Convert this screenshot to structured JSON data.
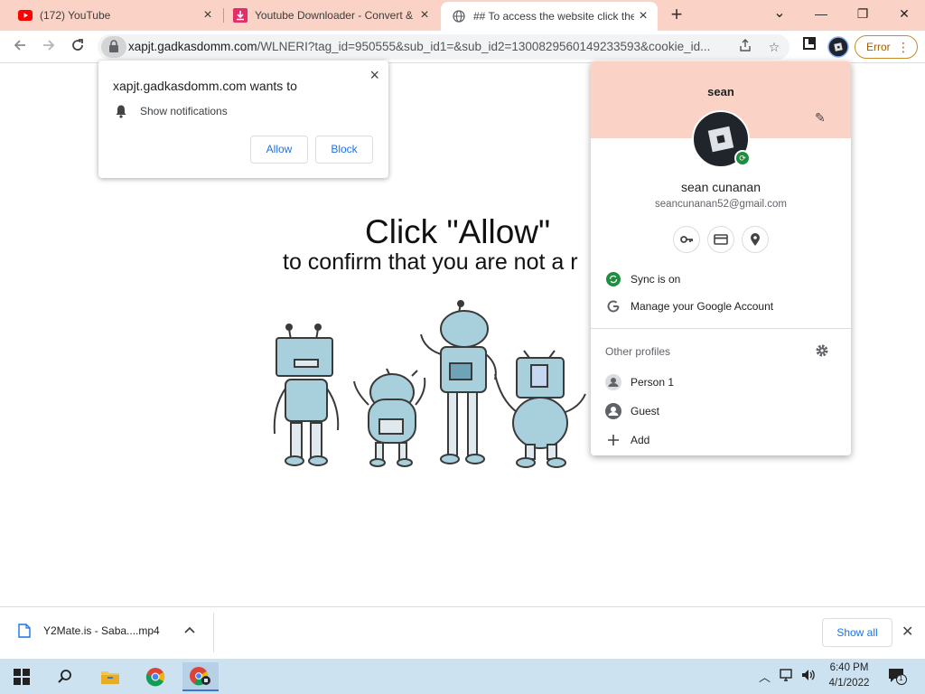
{
  "tabs": [
    {
      "title": "(172) YouTube",
      "icon": "youtube-icon"
    },
    {
      "title": "Youtube Downloader - Convert & ",
      "icon": "download-icon"
    },
    {
      "title": "## To access the website click the",
      "icon": "globe-icon",
      "active": true
    }
  ],
  "window": {
    "minimize": "—",
    "restore": "❐",
    "close": "✕",
    "tab_list": "⌄",
    "new_tab": "+"
  },
  "toolbar": {
    "url_domain": "xapjt.gadkasdomm.com",
    "url_path": "/WLNERI?tag_id=950555&sub_id1=&sub_id2=1300829560149233593&cookie_id...",
    "error_label": "Error"
  },
  "notification": {
    "title": "xapjt.gadkasdomm.com wants to",
    "message": "Show notifications",
    "allow": "Allow",
    "block": "Block",
    "close": "×"
  },
  "page": {
    "headline": "Click \"Allow\"",
    "subline": "to confirm that you are not a r"
  },
  "profile": {
    "name": "sean",
    "full_name": "sean cunanan",
    "email": "seancunanan52@gmail.com",
    "sync": "Sync is on",
    "manage": "Manage your Google Account",
    "other_profiles": "Other profiles",
    "person1": "Person 1",
    "guest": "Guest",
    "add": "Add"
  },
  "downloads": {
    "file": "Y2Mate.is - Saba....mp4",
    "show_all": "Show all"
  },
  "taskbar": {
    "time": "6:40 PM",
    "date": "4/1/2022",
    "notifications": "1"
  },
  "colors": {
    "tab_strip": "#fbd3c6",
    "accent_blue": "#1a73e8",
    "error_orange": "#a35b00",
    "sync_green": "#1e8e3e",
    "robot_blue": "#a8d0dc"
  }
}
